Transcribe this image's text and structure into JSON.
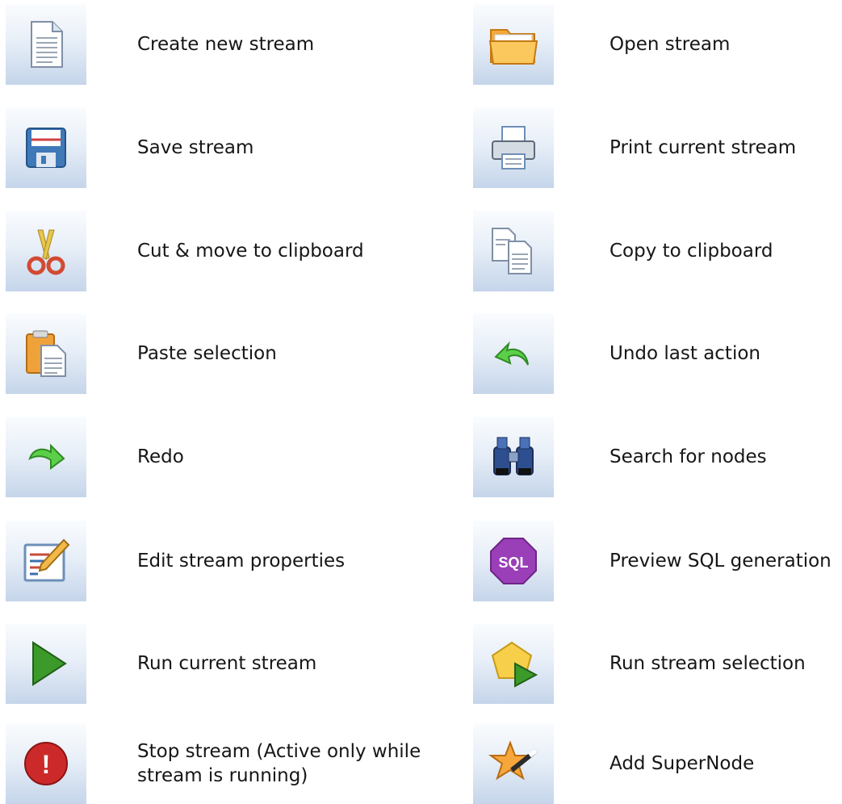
{
  "toolbar_legend": {
    "rows": [
      {
        "left": {
          "icon": "new-document-icon",
          "label": "Create new stream"
        },
        "right": {
          "icon": "open-folder-icon",
          "label": "Open stream"
        }
      },
      {
        "left": {
          "icon": "floppy-disk-icon",
          "label": "Save stream"
        },
        "right": {
          "icon": "printer-icon",
          "label": "Print current stream"
        }
      },
      {
        "left": {
          "icon": "scissors-icon",
          "label": "Cut & move to clipboard"
        },
        "right": {
          "icon": "copy-icon",
          "label": "Copy to clipboard"
        }
      },
      {
        "left": {
          "icon": "paste-icon",
          "label": "Paste selection"
        },
        "right": {
          "icon": "undo-arrow-icon",
          "label": "Undo last action"
        }
      },
      {
        "left": {
          "icon": "redo-arrow-icon",
          "label": "Redo"
        },
        "right": {
          "icon": "binoculars-icon",
          "label": "Search for nodes"
        }
      },
      {
        "left": {
          "icon": "edit-properties-icon",
          "label": "Edit stream properties"
        },
        "right": {
          "icon": "sql-icon",
          "label": "Preview SQL generation",
          "icon_text": "SQL"
        }
      },
      {
        "left": {
          "icon": "play-icon",
          "label": "Run current stream"
        },
        "right": {
          "icon": "run-selection-icon",
          "label": "Run stream selection"
        }
      },
      {
        "left": {
          "icon": "stop-alert-icon",
          "label": "Stop stream (Active only while stream is running)",
          "icon_text": "!"
        },
        "right": {
          "icon": "star-wand-icon",
          "label": "Add SuperNode"
        }
      }
    ]
  },
  "colors": {
    "tile_top": "#fafcfe",
    "tile_bottom": "#c5d5ea",
    "text": "#161616"
  }
}
